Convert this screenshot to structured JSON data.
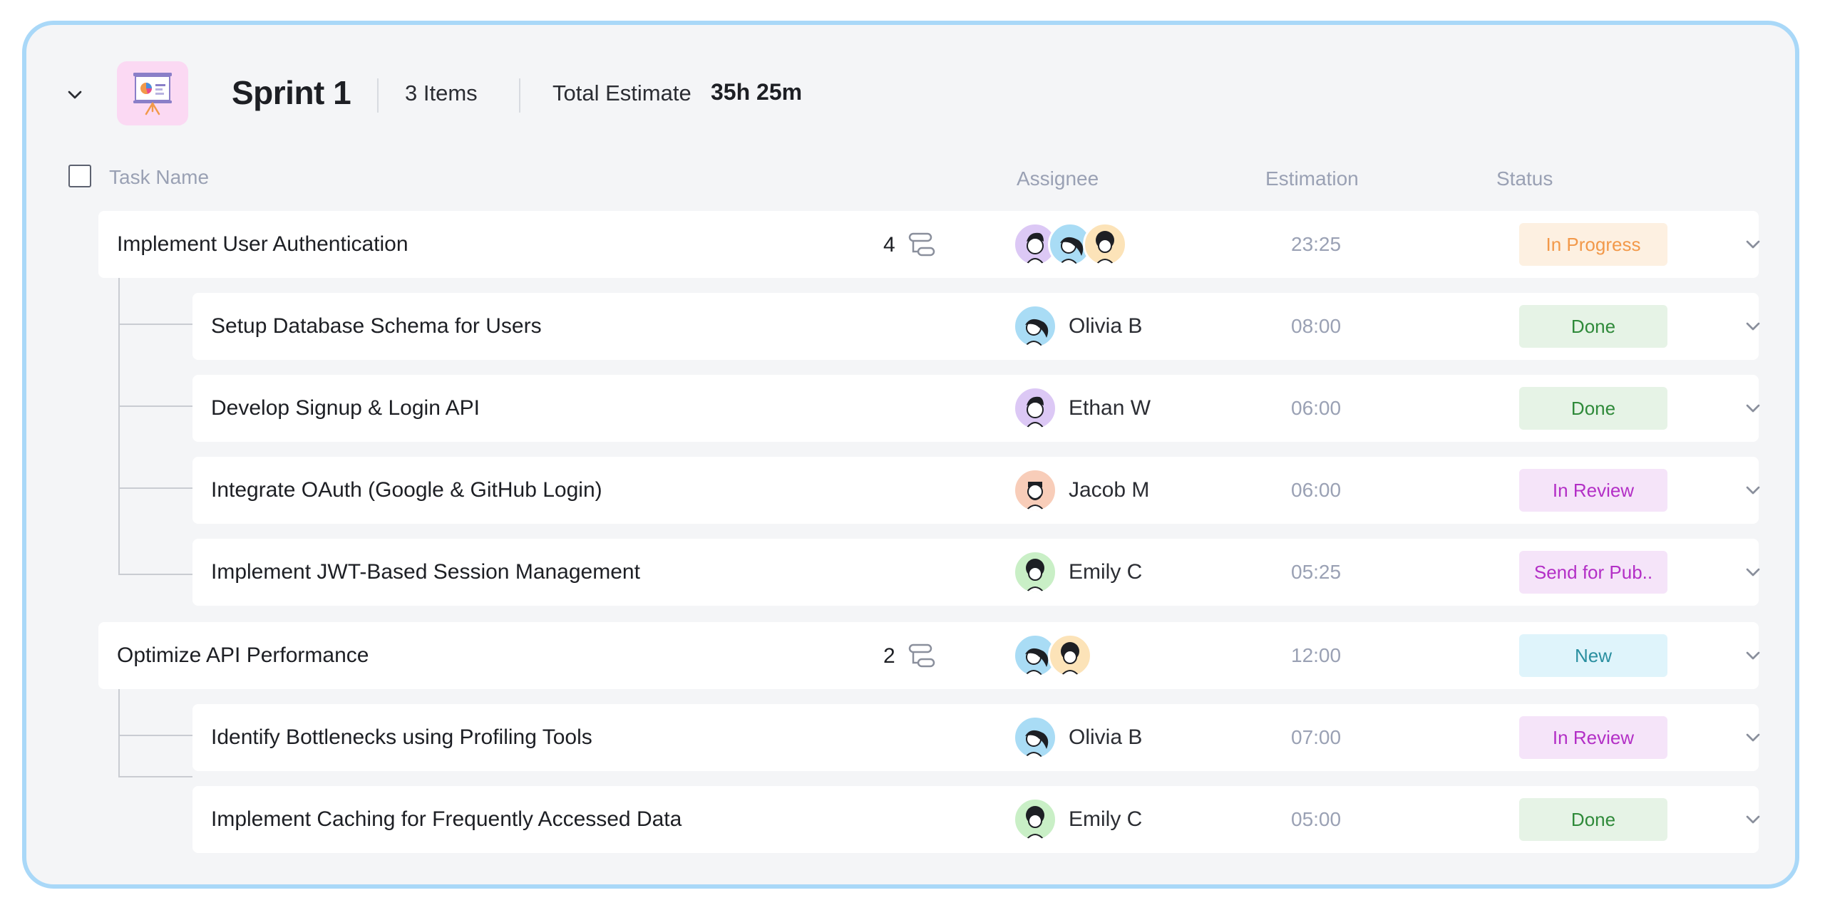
{
  "sprint": {
    "title": "Sprint 1",
    "items_count": "3 Items",
    "total_estimate_label": "Total Estimate",
    "total_estimate_value": "35h 25m",
    "icon": "presentation-chart-icon"
  },
  "columns": {
    "task_name": "Task Name",
    "assignee": "Assignee",
    "estimation": "Estimation",
    "status": "Status"
  },
  "statuses": {
    "in_progress": {
      "label": "In Progress",
      "bg": "#fdf0e1",
      "fg": "#f2994a"
    },
    "done": {
      "label": "Done",
      "bg": "#e6f3e6",
      "fg": "#2f8a3a"
    },
    "in_review": {
      "label": "In Review",
      "bg": "#f5e4f9",
      "fg": "#b32fc6"
    },
    "send_for_pub": {
      "label": "Send for Pub..",
      "bg": "#f5e4f9",
      "fg": "#b32fc6"
    },
    "new": {
      "label": "New",
      "bg": "#dff4fb",
      "fg": "#2a8fa0"
    }
  },
  "tasks": [
    {
      "name": "Implement User Authentication",
      "subtask_count": "4",
      "assignees": [
        "ethan",
        "olivia",
        "emily"
      ],
      "estimation": "23:25",
      "status": "In Progress",
      "subtasks": [
        {
          "name": "Setup Database Schema for Users",
          "assignee": "Olivia B",
          "estimation": "08:00",
          "status": "Done"
        },
        {
          "name": "Develop Signup & Login API",
          "assignee": "Ethan W",
          "estimation": "06:00",
          "status": "Done"
        },
        {
          "name": "Integrate OAuth (Google & GitHub Login)",
          "assignee": "Jacob M",
          "estimation": "06:00",
          "status": "In Review"
        },
        {
          "name": "Implement JWT-Based Session Management",
          "assignee": "Emily C",
          "estimation": "05:25",
          "status": "Send for Pub.."
        }
      ]
    },
    {
      "name": "Optimize API Performance",
      "subtask_count": "2",
      "assignees": [
        "olivia",
        "emily"
      ],
      "estimation": "12:00",
      "status": "New",
      "subtasks": [
        {
          "name": "Identify Bottlenecks using Profiling Tools",
          "assignee": "Olivia B",
          "estimation": "07:00",
          "status": "In Review"
        },
        {
          "name": "Implement Caching for Frequently Accessed Data",
          "assignee": "Emily C",
          "estimation": "05:00",
          "status": "Done"
        }
      ]
    }
  ],
  "avatar_colors": {
    "olivia": "#a9dcf5",
    "ethan": "#dcc8f5",
    "jacob": "#f8cdb9",
    "emily": "#c9efc6",
    "emily_group": "#fce3b8"
  }
}
